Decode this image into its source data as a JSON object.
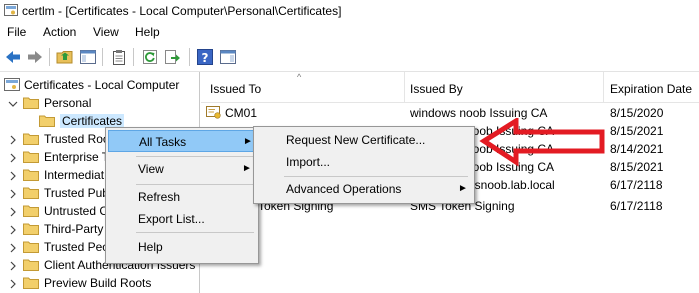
{
  "window": {
    "title": "certlm - [Certificates - Local Computer\\Personal\\Certificates]"
  },
  "menu": [
    "File",
    "Action",
    "View",
    "Help"
  ],
  "tree": {
    "root": "Certificates - Local Computer",
    "personal": "Personal",
    "certificates": "Certificates",
    "items": [
      "Trusted Roo",
      "Enterprise T",
      "Intermediat",
      "Trusted Pub",
      "Untrusted C",
      "Third-Party",
      "Trusted Peo",
      "Client Authentication Issuers",
      "Preview Build Roots"
    ]
  },
  "list": {
    "columns": [
      "Issued To",
      "Issued By",
      "Expiration Date"
    ],
    "rows": [
      [
        "CM01",
        "windows noob Issuing CA",
        "8/15/2020"
      ],
      [
        "",
        "noob Issuing CA",
        "8/15/2021"
      ],
      [
        "",
        "noob Issuing CA",
        "8/14/2021"
      ],
      [
        "",
        "noob Issuing CA",
        "8/15/2021"
      ],
      [
        "",
        "wsnoob.lab.local",
        "6/17/2118"
      ],
      [
        "Token Signing",
        "SMS Token Signing",
        "6/17/2118"
      ]
    ]
  },
  "context_menu": {
    "items": [
      "All Tasks",
      "View",
      "Refresh",
      "Export List...",
      "Help"
    ]
  },
  "submenu": {
    "items": [
      "Request New Certificate...",
      "Import...",
      "Advanced Operations"
    ]
  },
  "colors": {
    "highlight": "#91c9f7",
    "arrow": "#e31b23",
    "selection": "#cce8ff"
  }
}
